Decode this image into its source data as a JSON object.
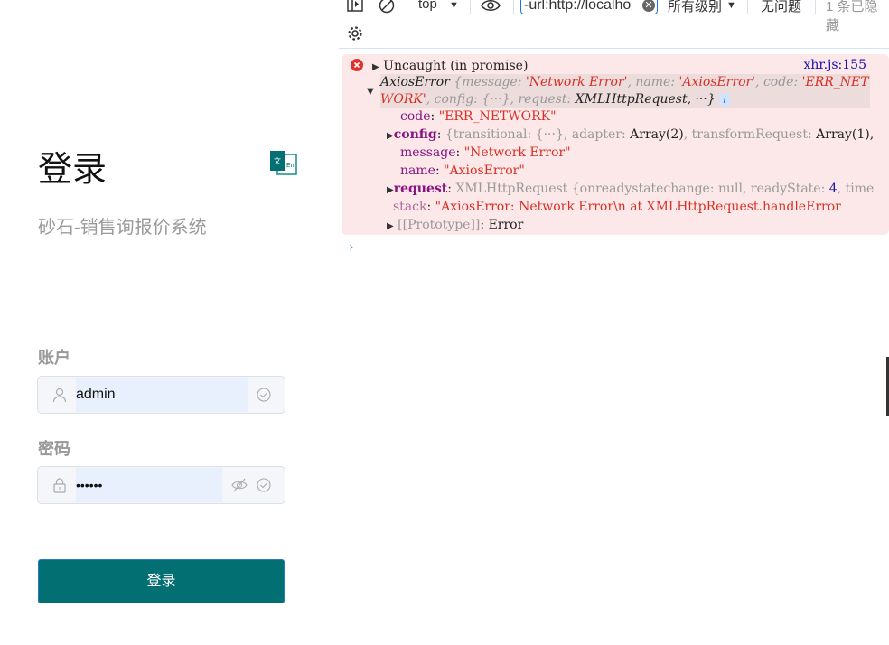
{
  "login": {
    "title": "登录",
    "subtitle": "砂石-销售询报价系统",
    "account_label": "账户",
    "account_value": "admin",
    "password_label": "密码",
    "password_value": "••••••",
    "submit_label": "登录",
    "lang_icon_text_zh": "文",
    "lang_icon_text_en": "En",
    "accent": "#026f72"
  },
  "devtools": {
    "toolbar": {
      "context": "top",
      "filter": "-url:http://localho",
      "levels": "所有级别",
      "issues": "无问题",
      "hidden": "1 条已隐藏"
    },
    "error": {
      "title": "Uncaught (in promise)",
      "source": "xhr.js:155",
      "summary1_a": "AxiosError ",
      "summary1_b": "{message: ",
      "summary1_c": "'Network Error'",
      "summary1_d": ", name: ",
      "summary1_e": "'AxiosError'",
      "summary1_f": ", code: ",
      "summary1_g": "'ERR_NET",
      "summary2_a": "WORK'",
      "summary2_b": ", config: {···}, request: ",
      "summary2_c": "XMLHttpRequest, ···}",
      "info": "i",
      "code_key": "code",
      "code_val": "\"ERR_NETWORK\"",
      "config_key": "config",
      "config_val_a": "{transitional: {···}, adapter: ",
      "config_val_b": "Array(2)",
      "config_val_c": ", transformRequest: ",
      "config_val_d": "Array(1),",
      "message_key": "message",
      "message_val": "\"Network Error\"",
      "name_key": "name",
      "name_val": "\"AxiosError\"",
      "request_key": "request",
      "request_val_a": "XMLHttpRequest {onreadystatechange: ",
      "request_val_b": "null",
      "request_val_c": ", readyState: ",
      "request_val_d": "4",
      "request_val_e": ", time",
      "stack_key": "stack",
      "stack_val": "\"AxiosError: Network Error\\n    at XMLHttpRequest.handleError",
      "proto_key": "[[Prototype]]",
      "proto_val": "Error"
    }
  }
}
